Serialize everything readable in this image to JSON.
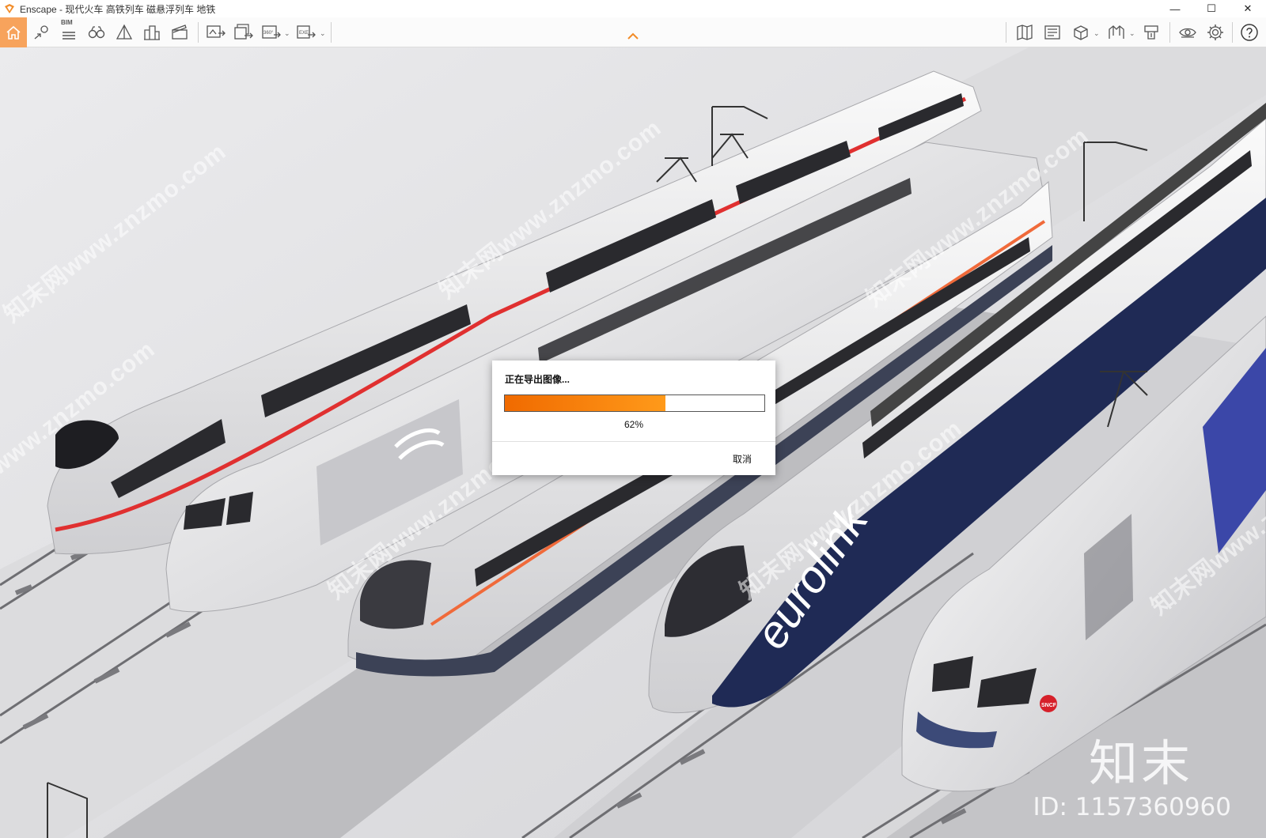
{
  "window": {
    "title": "Enscape - 现代火车 高铁列车 磁悬浮列车 地铁",
    "controls": {
      "minimize": "—",
      "maximize": "☐",
      "close": "✕"
    }
  },
  "toolbar": {
    "left_tools": [
      "home-icon",
      "location-icon",
      "bim-icon",
      "binoculars-icon",
      "atmosphere-icon",
      "buildings-icon",
      "video-editor-icon",
      "screenshot-export-icon",
      "batch-render-icon",
      "panorama-export-icon",
      "exe-export-icon"
    ],
    "bim_label": "BIM",
    "panorama_label": "360°",
    "exe_label": "EXE",
    "right_tools": [
      "map-icon",
      "asset-library-icon",
      "material-icon",
      "views-icon",
      "upload-icon",
      "visual-settings-icon",
      "settings-icon",
      "help-icon"
    ],
    "accent_color": "#f7a35c"
  },
  "dialog": {
    "title": "正在导出图像...",
    "progress_percent": 62,
    "progress_label": "62%",
    "cancel_label": "取消",
    "progress_color": "#f57c0f"
  },
  "scene": {
    "train_livery_text": "eurolink",
    "badge_text": "SNCF",
    "watermark_text": "知末网www.znzmo.com",
    "brand": "知末",
    "brand_id": "ID: 1157360960"
  }
}
